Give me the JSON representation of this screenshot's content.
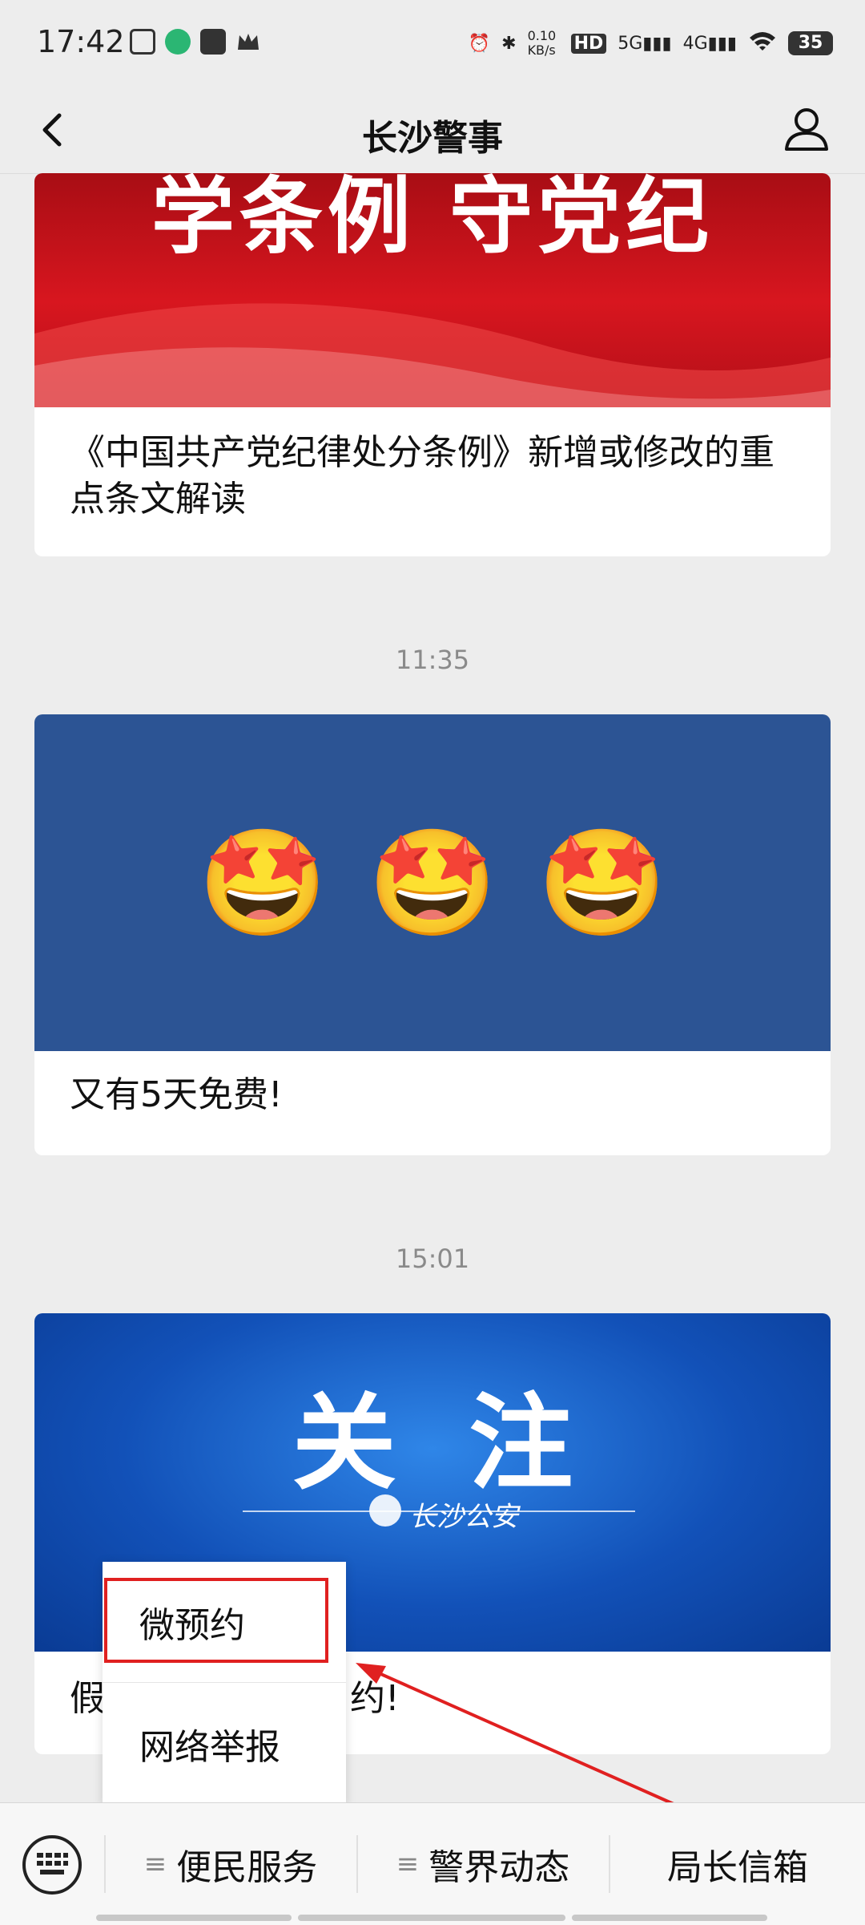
{
  "status_bar": {
    "time": "17:42",
    "net_speed": "0.10 KB/s",
    "hd": "HD",
    "sim1": "5G",
    "sim2": "4G",
    "battery": "35"
  },
  "nav": {
    "title": "长沙警事"
  },
  "feed": [
    {
      "image_text": "学条例 守党纪",
      "caption": "《中国共产党纪律处分条例》新增或修改的重点条文解读"
    },
    {
      "timestamp": "11:35",
      "image_emoji": [
        "🤩",
        "🤩",
        "🤩"
      ],
      "caption": "又有5天免费!"
    },
    {
      "timestamp": "15:01",
      "image_text": "关  注",
      "image_logo_text": "长沙公安",
      "caption_visible_start": "假",
      "caption_visible_end": "约!"
    }
  ],
  "popup_menu": {
    "items": [
      "微预约",
      "网络举报"
    ]
  },
  "bottom_menu": {
    "items": [
      "便民服务",
      "警界动态",
      "局长信箱"
    ]
  },
  "colors": {
    "annotation": "#e02020",
    "card1_bg": "#c8141a",
    "card2_bg": "#2c5494",
    "card3_bg": "#1251b8"
  }
}
